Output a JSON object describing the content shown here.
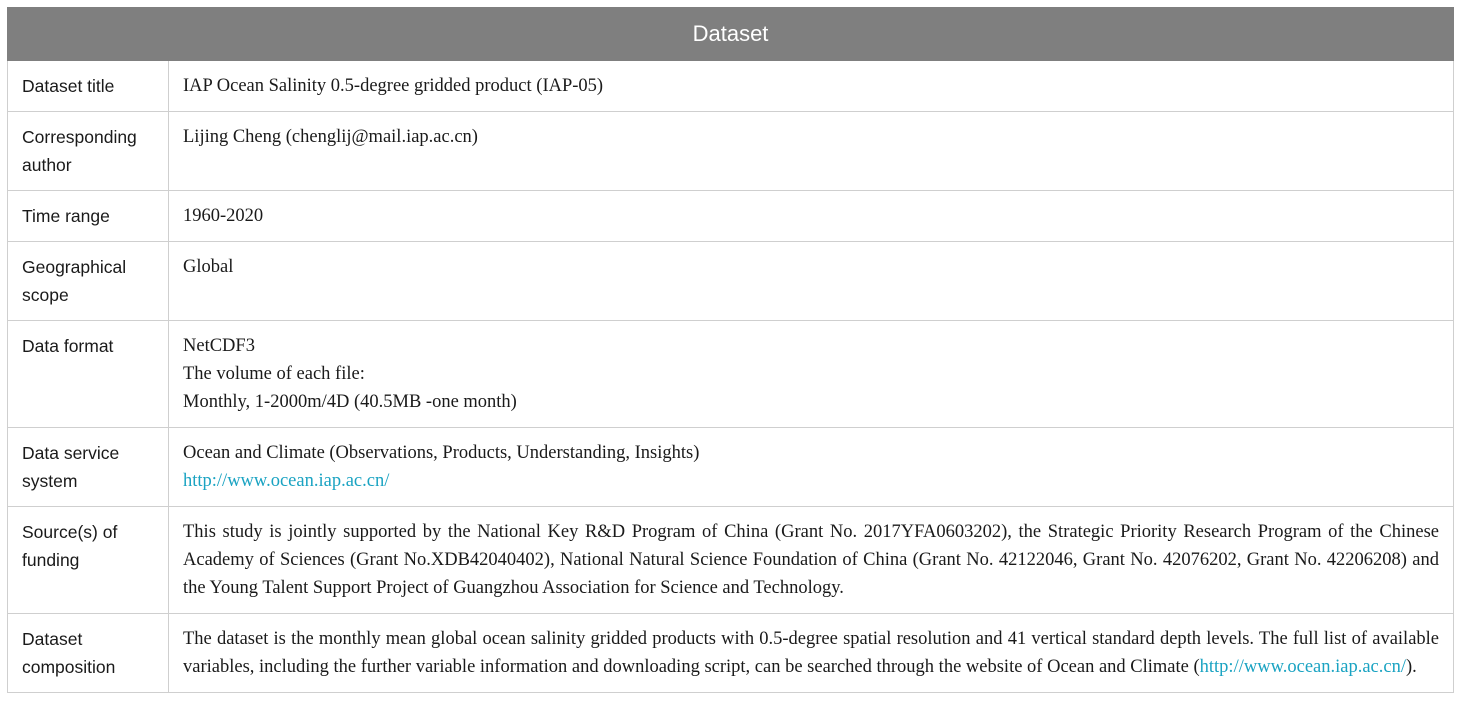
{
  "table": {
    "header": "Dataset",
    "rows": [
      {
        "label": "Dataset title",
        "value": "IAP Ocean Salinity 0.5-degree gridded product (IAP-05)"
      },
      {
        "label": "Corresponding author",
        "value": "Lijing Cheng (chenglij@mail.iap.ac.cn)"
      },
      {
        "label": "Time range",
        "value": "1960-2020"
      },
      {
        "label": "Geographical scope",
        "value": "Global"
      },
      {
        "label": "Data format",
        "lines": [
          "NetCDF3",
          "The volume of each file:",
          "Monthly, 1-2000m/4D (40.5MB -one month)"
        ]
      },
      {
        "label": "Data service system",
        "line1": "Ocean and Climate (Observations, Products, Understanding, Insights)",
        "link": "http://www.ocean.iap.ac.cn/"
      },
      {
        "label": "Source(s) of funding",
        "value": "This study is jointly supported by the National Key R&D Program of China (Grant No. 2017YFA0603202), the Strategic Priority Research Program of the Chinese Academy of Sciences (Grant No.XDB42040402), National Natural Science Foundation of China (Grant No. 42122046, Grant No. 42076202, Grant No. 42206208) and the Young Talent Support Project of Guangzhou Association for Science and Technology."
      },
      {
        "label": "Dataset composition",
        "text_before": "The dataset is the monthly mean global ocean salinity gridded products with 0.5-degree spatial resolution and 41 vertical standard depth levels. The full list of available variables, including the further variable information and downloading script, can be searched through the website of Ocean and Climate (",
        "link": "http://www.ocean.iap.ac.cn/",
        "text_after": ")."
      }
    ]
  },
  "colors": {
    "header_bg": "#7f7f7f",
    "header_text": "#ffffff",
    "border": "#cfcfcf",
    "link": "#1aa3c2"
  }
}
